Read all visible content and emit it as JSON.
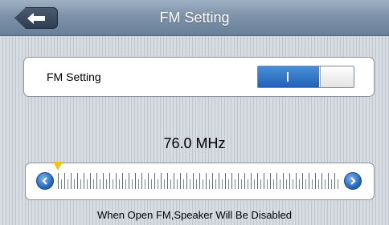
{
  "header": {
    "title": "FM Setting",
    "back_icon": "arrow-left-icon"
  },
  "setting": {
    "label": "FM Setting",
    "toggle_state": "on"
  },
  "tuner": {
    "frequency": "76.0 MHz",
    "range_position": 0.0
  },
  "footer": {
    "note": "When Open FM,Speaker Will Be Disabled"
  },
  "colors": {
    "accent": "#1f62b8",
    "header": "#7d92aa",
    "marker": "#f0c419"
  }
}
